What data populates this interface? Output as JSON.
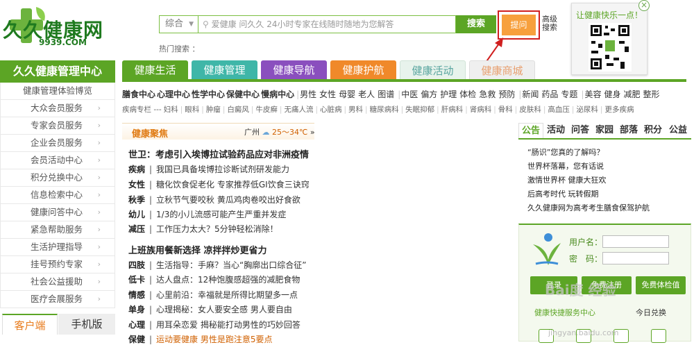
{
  "logo": {
    "name": "久久健康网",
    "url_text": "9939.COM"
  },
  "search": {
    "select_value": "综合",
    "placeholder": "爱健康 问久久 24小时专家在线随时随地为您解答",
    "button_label": "搜索",
    "ask_label": "提问",
    "advanced_label": "高级搜索",
    "hot_label": "热门搜索 ："
  },
  "qr": {
    "title": "让健康快乐一点！",
    "close": "×"
  },
  "sidebar": {
    "title": "久久健康管理中心",
    "items": [
      {
        "label": "健康管理体验博览"
      },
      {
        "label": "大众会员服务"
      },
      {
        "label": "专家会员服务"
      },
      {
        "label": "企业会员服务"
      },
      {
        "label": "会员活动中心"
      },
      {
        "label": "积分兑换中心"
      },
      {
        "label": "信息检索中心"
      },
      {
        "label": "健康问答中心"
      },
      {
        "label": "紧急帮助服务"
      },
      {
        "label": "生活护理指导"
      },
      {
        "label": "挂号预约专家"
      },
      {
        "label": "社会公益援助"
      },
      {
        "label": "医疗会展服务"
      }
    ],
    "chevron": "›",
    "client_tab": "客户端",
    "mobile_tab": "手机版"
  },
  "nav_tabs": [
    {
      "label": "健康生活",
      "color": "#5ca525"
    },
    {
      "label": "健康管理",
      "color": "#3fb6a8"
    },
    {
      "label": "健康导航",
      "color": "#8a4fbe"
    },
    {
      "label": "健康护航",
      "color": "#f0892a"
    },
    {
      "label": "健康活动",
      "color": "#e8f3ec"
    },
    {
      "label": "健康商城",
      "color": "#efefef"
    }
  ],
  "subnav": {
    "groups": [
      "膳食中心",
      "心理中心",
      "性学中心",
      "保健中心",
      "慢病中心"
    ],
    "people": [
      "男性",
      "女性",
      "母婴",
      "老人",
      "图谱"
    ],
    "med": [
      "中医",
      "偏方",
      "护理",
      "体检",
      "急救",
      "预防"
    ],
    "news": [
      "新闻",
      "药品",
      "专题"
    ],
    "beauty": [
      "美容",
      "健身",
      "减肥",
      "整形"
    ],
    "disease_prefix": "疾病专栏 ---",
    "diseases": [
      "妇科",
      "眼科",
      "肿瘤",
      "白癜风",
      "牛皮癣",
      "无痛人流",
      "心脏病",
      "男科",
      "糖尿病科",
      "失眠抑郁",
      "肝病科",
      "肾病科",
      "骨科",
      "皮肤科",
      "高血压",
      "泌尿科",
      "更多疾病"
    ]
  },
  "focus": {
    "title": "健康聚焦",
    "weather_city": "广州",
    "weather_temp": "25～34℃",
    "weather_more": "»",
    "headline1": "世卫：考虑引入埃博拉试验药品应对非洲疫情",
    "group1": [
      {
        "cat": "疾病",
        "text": "我国已具备埃博拉诊断试剂研发能力"
      },
      {
        "cat": "女性",
        "text": "糖化饮食促老化 专家推荐低GI饮食三诀窍"
      },
      {
        "cat": "秋季",
        "text": "立秋节气要咬秋 黄瓜鸡肉卷咬出好食欲"
      },
      {
        "cat": "幼儿",
        "text": "1/3的小儿流感可能产生严重并发症"
      },
      {
        "cat": "减压",
        "text": "工作压力太大？5分钟轻松消除！"
      }
    ],
    "headline2": "上班族用餐新选择 凉拌拌炒更省力",
    "group2": [
      {
        "cat": "四肢",
        "text": "生活指导：手麻？当心“胸廓出口综合征”"
      },
      {
        "cat": "低卡",
        "text": "达人盘点：12种饱腹感超强的减肥食物"
      },
      {
        "cat": "情感",
        "text": "心里前沿：幸福就是所得比期望多一点"
      },
      {
        "cat": "单身",
        "text": "心理揭秘：女人要安全感 男人要自由"
      },
      {
        "cat": "心理",
        "text": "用耳朵恋爱 揭秘能打动男性的巧妙回答"
      },
      {
        "cat": "保健",
        "text": "运动要健康 男性是跑注意5要点"
      }
    ]
  },
  "notice": {
    "tabs": [
      "公告",
      "活动",
      "问答",
      "家园",
      "部落",
      "积分",
      "公益"
    ],
    "items": [
      "“肠识”您真的了解吗？",
      "世界杯落幕，您有话说",
      "激情世界杯 健康大狂欢",
      "后高考时代 玩转假期",
      "久久健康网为高考考生膳食保驾护航"
    ]
  },
  "login": {
    "user_label": "用户名：",
    "pass_label": "密　码：",
    "login_button": "登录",
    "register_button": "免费注册",
    "checkup_button": "免费体检值",
    "service_title": "健康快捷服务中心",
    "redeem_label": "今日兑换"
  },
  "watermark": {
    "text": "Bai度 经验",
    "sub": "jingyan.baidu.com"
  }
}
